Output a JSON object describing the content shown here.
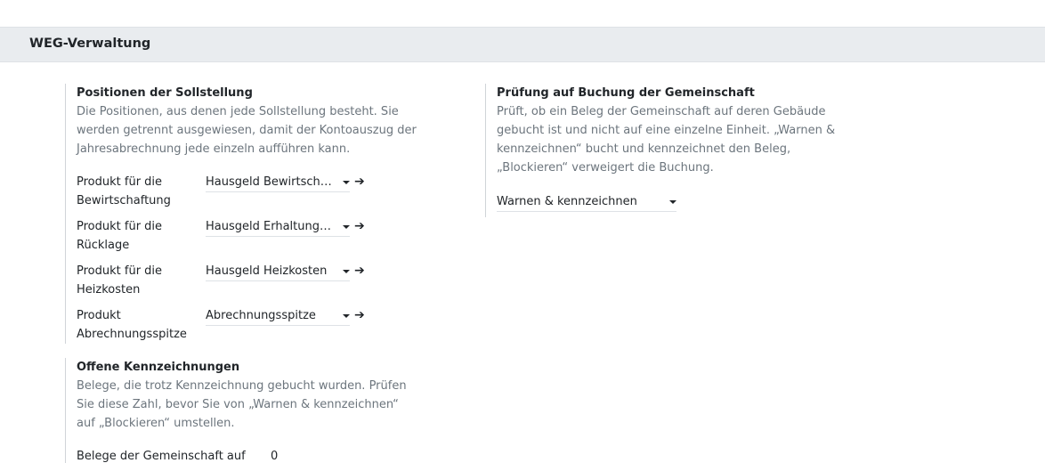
{
  "section": {
    "title": "WEG-Verwaltung"
  },
  "positions": {
    "title": "Positionen der Sollstellung",
    "description": "Die Positionen, aus denen jede Sollstellung besteht. Sie werden getrennt ausgewiesen, damit der Kontoauszug der Jahresabrechnung jede einzeln aufführen kann.",
    "fields": [
      {
        "label": "Produkt für die Bewirtschaftung",
        "value": "Hausgeld Bewirtschaftung"
      },
      {
        "label": "Produkt für die Rücklage",
        "value": "Hausgeld Erhaltungsrücklage"
      },
      {
        "label": "Produkt für die Heizkosten",
        "value": "Hausgeld Heizkosten"
      },
      {
        "label": "Produkt Abrechnungsspitze",
        "value": "Abrechnungsspitze"
      }
    ],
    "arrow_glyph": "➔"
  },
  "check": {
    "title": "Prüfung auf Buchung der Gemeinschaft",
    "description": "Prüft, ob ein Beleg der Gemeinschaft auf deren Gebäude gebucht ist und nicht auf eine einzelne Einheit. „Warnen & kennzeichnen“ bucht und kennzeichnet den Beleg, „Blockieren“ verweigert die Buchung.",
    "selected": "Warnen & kennzeichnen"
  },
  "open_flags": {
    "title": "Offene Kennzeichnungen",
    "description": "Belege, die trotz Kennzeichnung gebucht wurden. Prüfen Sie diese Zahl, bevor Sie von „Warnen & kennzeichnen“ auf „Blockieren“ umstellen.",
    "row_label": "Belege der Gemeinschaft auf",
    "row_value": "0"
  }
}
